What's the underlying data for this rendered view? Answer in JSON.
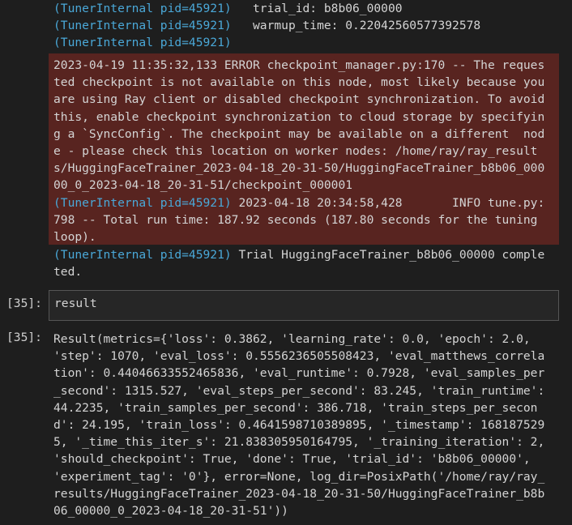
{
  "top_lines": [
    {
      "tag": "(TunerInternal pid=45921)",
      "text": "   trial_id: b8b06_00000"
    },
    {
      "tag": "(TunerInternal pid=45921)",
      "text": "   warmup_time: 0.22042560577392578"
    },
    {
      "tag": "(TunerInternal pid=45921)",
      "text": ""
    }
  ],
  "error_lines": [
    {
      "tag": "",
      "text": "2023-04-19 11:35:32,133 ERROR checkpoint_manager.py:170 -- The reques"
    },
    {
      "tag": "",
      "text": "ted checkpoint is not available on this node, most likely because you"
    },
    {
      "tag": "",
      "text": "are using Ray client or disabled checkpoint synchronization. To avoid"
    },
    {
      "tag": "",
      "text": "this, enable checkpoint synchronization to cloud storage by specifyin"
    },
    {
      "tag": "",
      "text": "g a `SyncConfig`. The checkpoint may be available on a different  nod"
    },
    {
      "tag": "",
      "text": "e - please check this location on worker nodes: /home/ray/ray_result"
    },
    {
      "tag": "",
      "text": "s/HuggingFaceTrainer_2023-04-18_20-31-50/HuggingFaceTrainer_b8b06_000"
    },
    {
      "tag": "",
      "text": "00_0_2023-04-18_20-31-51/checkpoint_000001"
    },
    {
      "tag": "(TunerInternal pid=45921)",
      "text": " 2023-04-18 20:34:58,428       INFO tune.py:"
    },
    {
      "tag": "",
      "text": "798 -- Total run time: 187.92 seconds (187.80 seconds for the tuning"
    },
    {
      "tag": "",
      "text": "loop)."
    }
  ],
  "after_lines": [
    {
      "tag": "(TunerInternal pid=45921)",
      "text": " Trial HuggingFaceTrainer_b8b06_00000 comple"
    },
    {
      "tag": "",
      "text": "ted."
    }
  ],
  "input_cell": {
    "prompt": "[35]:",
    "code": "result"
  },
  "output_cell": {
    "prompt": "[35]:",
    "lines": [
      "Result(metrics={'loss': 0.3862, 'learning_rate': 0.0, 'epoch': 2.0,",
      "'step': 1070, 'eval_loss': 0.5556236505508423, 'eval_matthews_correla",
      "tion': 0.44046633552465836, 'eval_runtime': 0.7928, 'eval_samples_per",
      "_second': 1315.527, 'eval_steps_per_second': 83.245, 'train_runtime':",
      "44.2235, 'train_samples_per_second': 386.718, 'train_steps_per_secon",
      "d': 24.195, 'train_loss': 0.4641598710389895, '_timestamp': 168187529",
      "5, '_time_this_iter_s': 21.838305950164795, '_training_iteration': 2,",
      "'should_checkpoint': True, 'done': True, 'trial_id': 'b8b06_00000',",
      "'experiment_tag': '0'}, error=None, log_dir=PosixPath('/home/ray/ray_",
      "results/HuggingFaceTrainer_2023-04-18_20-31-50/HuggingFaceTrainer_b8b",
      "06_00000_0_2023-04-18_20-31-51'))"
    ]
  }
}
